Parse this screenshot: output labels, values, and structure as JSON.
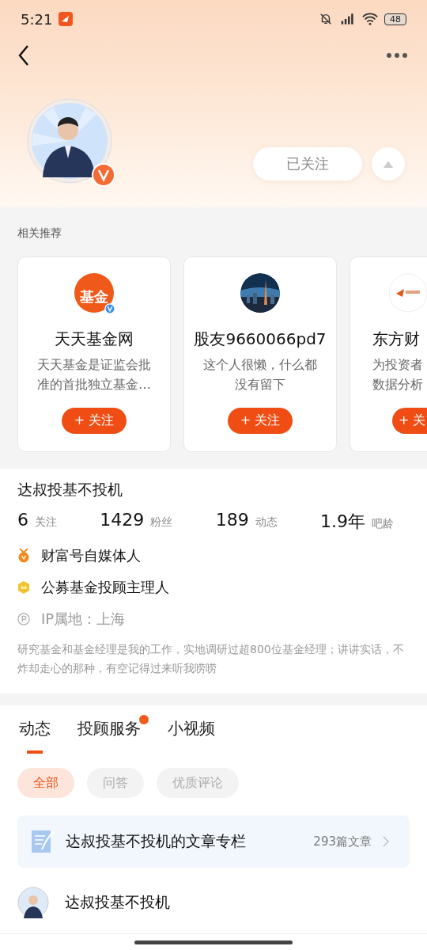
{
  "status_bar": {
    "time": "5:21",
    "battery": "48"
  },
  "profile": {
    "follow_button": "已关注",
    "verified": true
  },
  "recommendations": {
    "title": "相关推荐",
    "cards": [
      {
        "kind": "logo",
        "logo_text": "基金",
        "verified": true,
        "name": "天天基金网",
        "desc": "天天基金是证监会批准的首批独立基金…",
        "button": "+ 关注",
        "cut": false
      },
      {
        "kind": "picture",
        "verified": false,
        "name": "股友9660066pd7",
        "desc": "这个人很懒，什么都没有留下",
        "button": "+ 关注",
        "cut": false
      },
      {
        "kind": "brand",
        "verified": false,
        "name": "东方财",
        "desc": "为投资者数据分析",
        "button": "+ 关",
        "cut": true
      }
    ]
  },
  "user": {
    "name": "达叔投基不投机",
    "stats": [
      {
        "value": "6",
        "label": "关注"
      },
      {
        "value": "1429",
        "label": "粉丝"
      },
      {
        "value": "189",
        "label": "动态"
      },
      {
        "value": "1.9年",
        "label": "吧龄"
      }
    ],
    "badges": [
      {
        "kind": "medal",
        "text": "财富号自媒体人"
      },
      {
        "kind": "crown",
        "text": "公募基金投顾主理人"
      },
      {
        "kind": "ip",
        "text": "IP属地：上海"
      }
    ],
    "bio": "研究基金和基金经理是我的工作，实地调研过超800位基金经理；讲讲实话，不炸却走心的那种，有空记得过来听我唠唠"
  },
  "tabs": [
    {
      "label": "动态",
      "selected": true,
      "dot": false
    },
    {
      "label": "投顾服务",
      "selected": false,
      "dot": true
    },
    {
      "label": "小视频",
      "selected": false,
      "dot": false
    }
  ],
  "filters": [
    {
      "label": "全部",
      "selected": true
    },
    {
      "label": "问答",
      "selected": false
    },
    {
      "label": "优质评论",
      "selected": false
    }
  ],
  "column": {
    "title": "达叔投基不投机的文章专栏",
    "count": "293篇文章"
  },
  "post": {
    "author": "达叔投基不投机"
  }
}
